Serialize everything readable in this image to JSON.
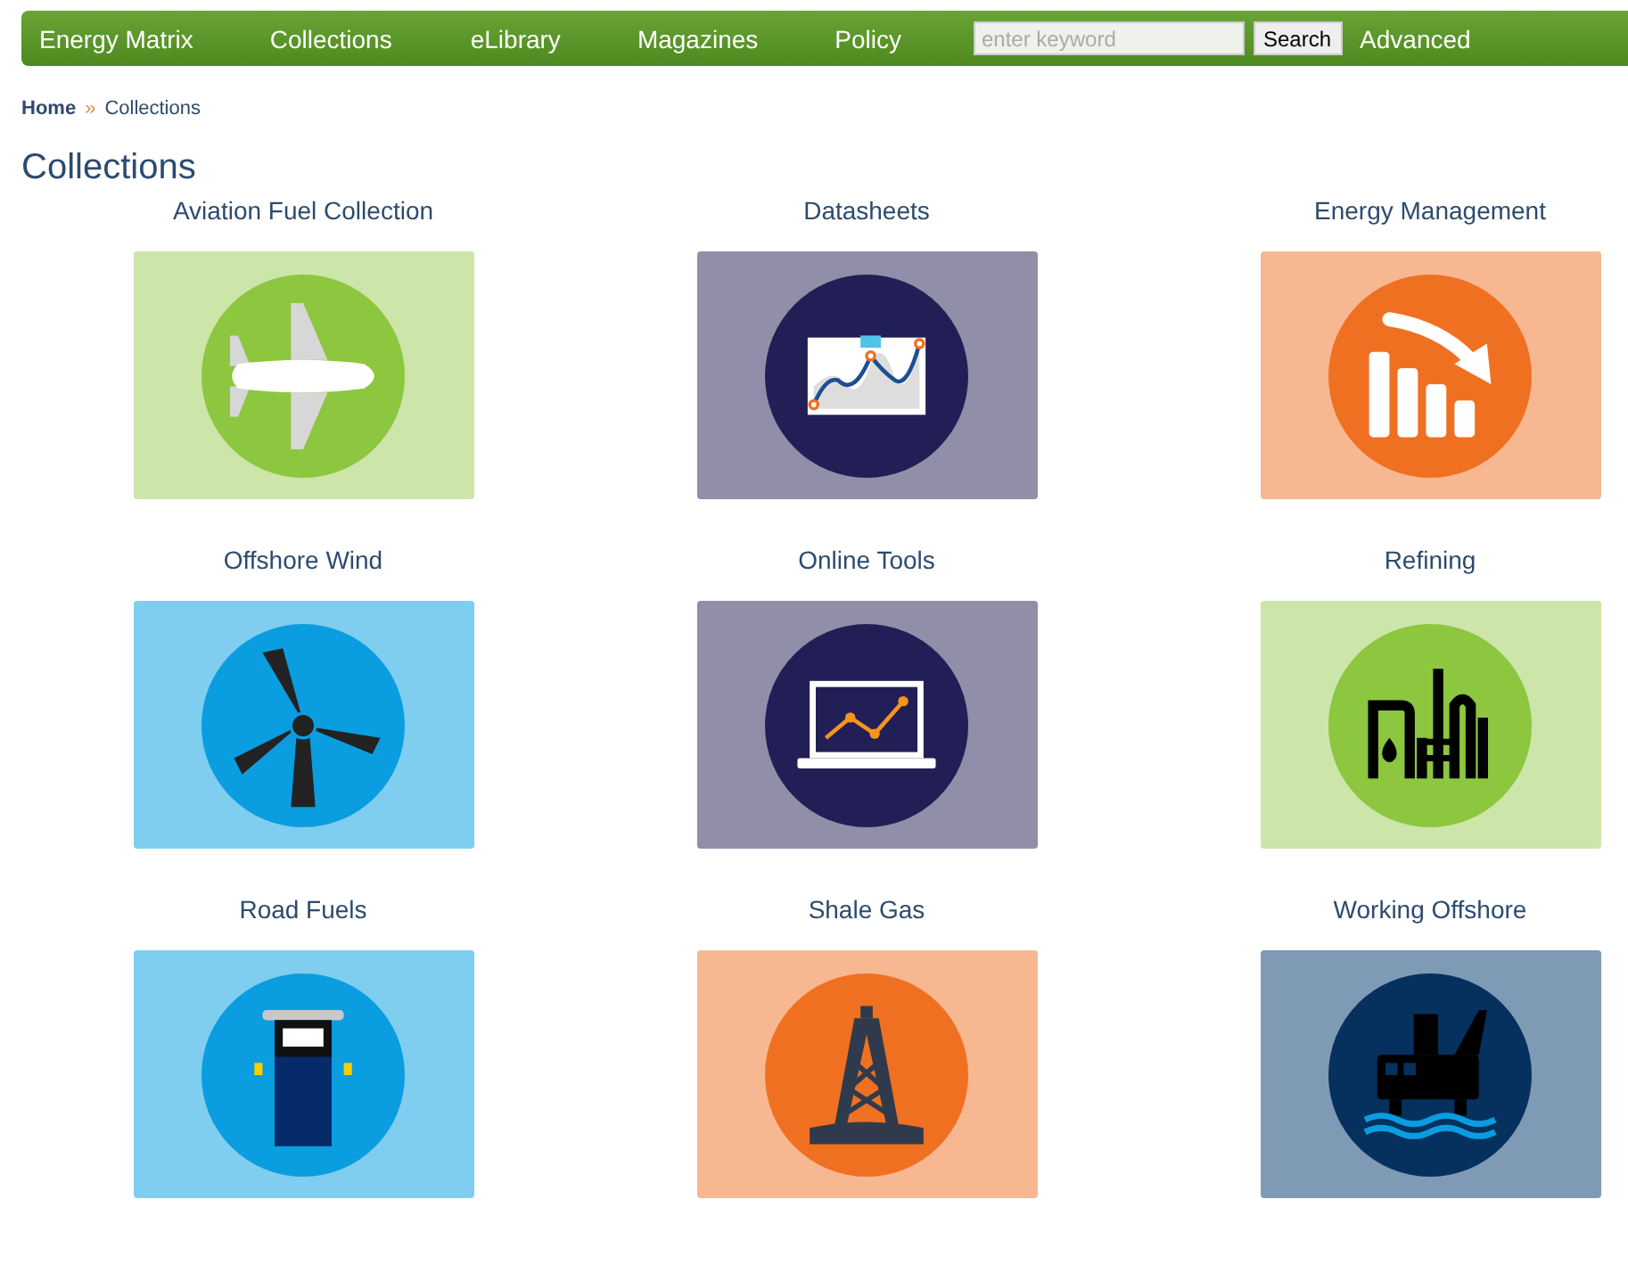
{
  "nav": {
    "brand": "Energy Matrix",
    "items": [
      "Collections",
      "eLibrary",
      "Magazines",
      "Policy"
    ],
    "search": {
      "placeholder": "enter keyword",
      "button": "Search"
    },
    "advanced": "Advanced"
  },
  "breadcrumb": {
    "home": "Home",
    "separator": "»",
    "current": "Collections"
  },
  "heading": "Collections",
  "collections": [
    {
      "title": "Aviation Fuel Collection",
      "kind": "plane"
    },
    {
      "title": "Datasheets",
      "kind": "chart"
    },
    {
      "title": "Energy Management",
      "kind": "decline"
    },
    {
      "title": "Offshore Wind",
      "kind": "turbine"
    },
    {
      "title": "Online Tools",
      "kind": "laptop"
    },
    {
      "title": "Refining",
      "kind": "refinery"
    },
    {
      "title": "Road Fuels",
      "kind": "pump"
    },
    {
      "title": "Shale Gas",
      "kind": "derrick"
    },
    {
      "title": "Working Offshore",
      "kind": "rig"
    }
  ]
}
